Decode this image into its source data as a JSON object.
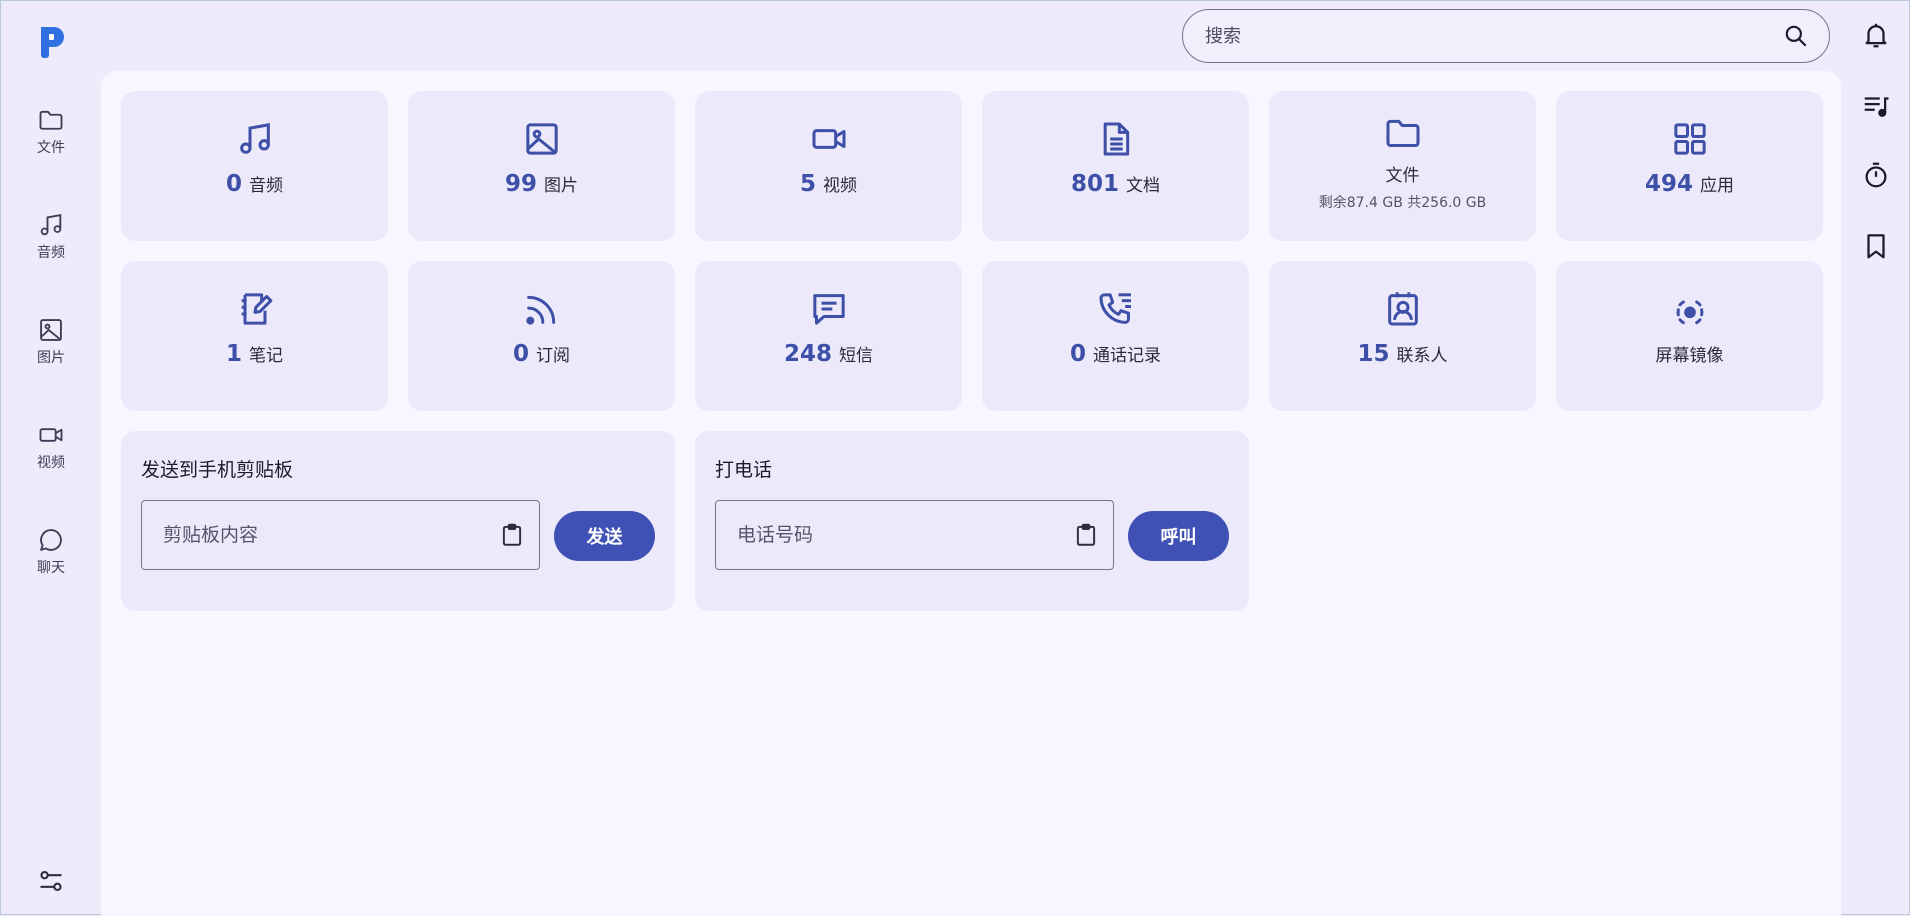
{
  "app": {
    "logo_letter": "P",
    "accent": "#3f51b5",
    "logo_color": "#2f6fe0"
  },
  "sidebar": {
    "items": [
      {
        "label": "文件",
        "icon": "folder-icon"
      },
      {
        "label": "音频",
        "icon": "music-icon"
      },
      {
        "label": "图片",
        "icon": "image-icon"
      },
      {
        "label": "视频",
        "icon": "video-icon"
      },
      {
        "label": "聊天",
        "icon": "chat-icon"
      }
    ],
    "settings_icon": "sliders-icon"
  },
  "search": {
    "placeholder": "搜索",
    "icon": "search-icon"
  },
  "right_rail": {
    "icons": [
      "bell-icon",
      "playlist-icon",
      "timer-icon",
      "bookmark-icon"
    ]
  },
  "cards": [
    {
      "count": "0",
      "label": "音频",
      "icon": "music-icon"
    },
    {
      "count": "99",
      "label": "图片",
      "icon": "image-icon"
    },
    {
      "count": "5",
      "label": "视频",
      "icon": "video-icon"
    },
    {
      "count": "801",
      "label": "文档",
      "icon": "document-icon"
    },
    {
      "label": "文件",
      "sub": "剩余87.4 GB 共256.0 GB",
      "icon": "folder-icon"
    },
    {
      "count": "494",
      "label": "应用",
      "icon": "apps-grid-icon"
    },
    {
      "count": "1",
      "label": "笔记",
      "icon": "notebook-icon"
    },
    {
      "count": "0",
      "label": "订阅",
      "icon": "rss-icon"
    },
    {
      "count": "248",
      "label": "短信",
      "icon": "message-icon"
    },
    {
      "count": "0",
      "label": "通话记录",
      "icon": "call-log-icon"
    },
    {
      "count": "15",
      "label": "联系人",
      "icon": "contact-icon"
    },
    {
      "label": "屏幕镜像",
      "icon": "screen-mirror-icon"
    }
  ],
  "clipboard_panel": {
    "title": "发送到手机剪贴板",
    "placeholder": "剪贴板内容",
    "button": "发送",
    "icon": "clipboard-icon"
  },
  "call_panel": {
    "title": "打电话",
    "placeholder": "电话号码",
    "button": "呼叫",
    "icon": "clipboard-icon"
  }
}
